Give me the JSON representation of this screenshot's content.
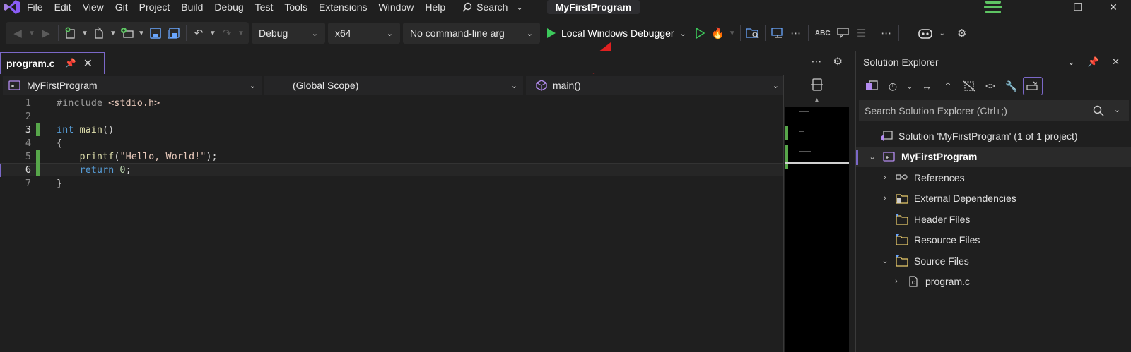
{
  "menu": {
    "items": [
      "File",
      "Edit",
      "View",
      "Git",
      "Project",
      "Build",
      "Debug",
      "Test",
      "Tools",
      "Extensions",
      "Window",
      "Help"
    ],
    "search_label": "Search",
    "title": "MyFirstProgram"
  },
  "toolbar": {
    "config": "Debug",
    "platform": "x64",
    "args": "No command-line arg",
    "run_label": "Local Windows Debugger",
    "spell_label": "ABC"
  },
  "editor": {
    "tab_title": "program.c",
    "nav_project": "MyFirstProgram",
    "nav_scope": "(Global Scope)",
    "nav_member": "main()",
    "lines": [
      {
        "n": "1",
        "parts": [
          [
            "pp",
            "#include "
          ],
          [
            "incl",
            "<stdio.h>"
          ]
        ]
      },
      {
        "n": "2",
        "parts": []
      },
      {
        "n": "3",
        "parts": [
          [
            "kw",
            "int "
          ],
          [
            "fn",
            "main"
          ],
          [
            "",
            "()"
          ]
        ]
      },
      {
        "n": "4",
        "parts": [
          [
            "",
            "{"
          ]
        ]
      },
      {
        "n": "5",
        "parts": [
          [
            "",
            "    "
          ],
          [
            "fn",
            "printf"
          ],
          [
            "",
            "("
          ],
          [
            "str",
            "\"Hello, World!\""
          ],
          [
            "",
            ");"
          ]
        ]
      },
      {
        "n": "6",
        "parts": [
          [
            "",
            "    "
          ],
          [
            "kw",
            "return "
          ],
          [
            "num",
            "0"
          ],
          [
            "",
            ";"
          ]
        ]
      },
      {
        "n": "7",
        "parts": [
          [
            "",
            "}"
          ]
        ]
      }
    ]
  },
  "solution_explorer": {
    "title": "Solution Explorer",
    "search_placeholder": "Search Solution Explorer (Ctrl+;)",
    "solution": "Solution 'MyFirstProgram' (1 of 1 project)",
    "project": "MyFirstProgram",
    "references": "References",
    "external_deps": "External Dependencies",
    "header_files": "Header Files",
    "resource_files": "Resource Files",
    "source_files": "Source Files",
    "file": "program.c"
  },
  "colors": {
    "accent": "#7b68c8",
    "run_green": "#3cc95b",
    "change_bar": "#57a64a",
    "arrow_red": "#e02020"
  }
}
